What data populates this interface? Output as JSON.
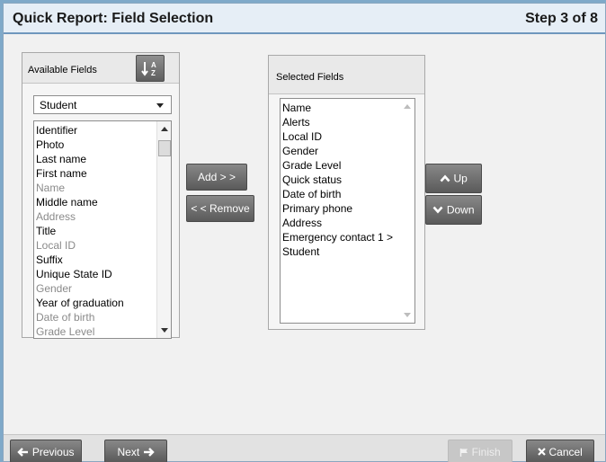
{
  "header": {
    "title": "Quick Report: Field Selection",
    "step": "Step 3 of 8"
  },
  "available": {
    "header_label": "Available Fields",
    "sort_icon": "sort-az-icon",
    "sort_glyph": "↓A Z",
    "category_selected": "Student",
    "items": [
      {
        "label": "Identifier",
        "dim": false
      },
      {
        "label": "Photo",
        "dim": false
      },
      {
        "label": "Last name",
        "dim": false
      },
      {
        "label": "First name",
        "dim": false
      },
      {
        "label": "Name",
        "dim": true
      },
      {
        "label": "Middle name",
        "dim": false
      },
      {
        "label": "Address",
        "dim": true
      },
      {
        "label": "Title",
        "dim": false
      },
      {
        "label": "Local ID",
        "dim": true
      },
      {
        "label": "Suffix",
        "dim": false
      },
      {
        "label": "Unique State ID",
        "dim": false
      },
      {
        "label": "Gender",
        "dim": true
      },
      {
        "label": "Year of graduation",
        "dim": false
      },
      {
        "label": "Date of birth",
        "dim": true
      },
      {
        "label": "Grade Level",
        "dim": true
      }
    ]
  },
  "selected": {
    "header_label": "Selected Fields",
    "items": [
      "Name",
      "Alerts",
      "Local ID",
      "Gender",
      "Grade Level",
      "Quick status",
      "Date of birth",
      "Primary phone",
      "Address",
      "Emergency contact 1 >",
      "Student"
    ]
  },
  "buttons": {
    "add": "Add > >",
    "remove": "< < Remove",
    "up": "Up",
    "down": "Down",
    "previous": "Previous",
    "next": "Next",
    "finish": "Finish",
    "cancel": "Cancel"
  },
  "icons": {
    "up": "chevron-up-icon",
    "down": "chevron-down-icon",
    "previous": "arrow-left-icon",
    "next": "arrow-right-icon",
    "finish": "flag-icon",
    "cancel": "close-icon"
  },
  "colors": {
    "title_bar": "#e6eef6",
    "title_rule": "#6f97bd",
    "button_dark": "#5e5e5e",
    "dim_text": "#8a8a8a"
  }
}
